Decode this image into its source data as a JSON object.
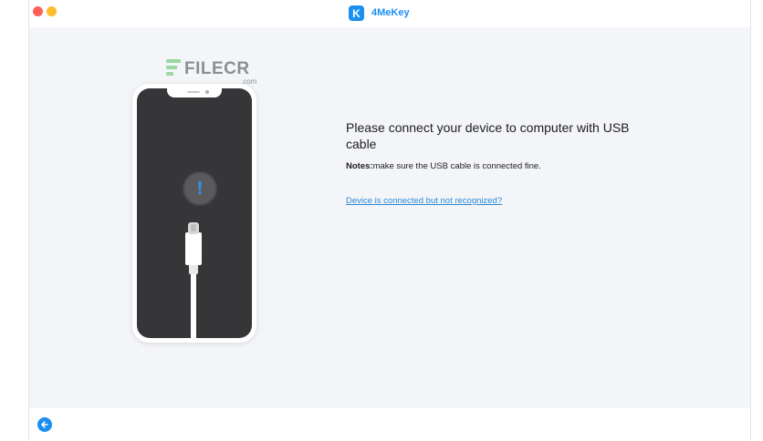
{
  "window": {
    "title": "4MeKey",
    "logo_letter": "K",
    "traffic_colors": {
      "close": "#fe5f57",
      "minimize": "#febc2e"
    }
  },
  "colors": {
    "accent": "#1a8ff0",
    "link": "#2a88d8",
    "alert": "#2e93ff"
  },
  "watermark": {
    "text": "FILECR",
    "domain": ".com"
  },
  "illustration": {
    "alert_symbol": "!",
    "icons": [
      "phone-illustration",
      "alert-icon",
      "usb-cable-icon"
    ]
  },
  "main": {
    "heading": "Please connect your device to computer with USB cable",
    "notes_label": "Notes:",
    "notes_text": "make sure the USB cable is connected fine.",
    "help_link": "Device is connected but not recognized?"
  },
  "footer": {
    "back_icon": "arrow-left-icon"
  }
}
